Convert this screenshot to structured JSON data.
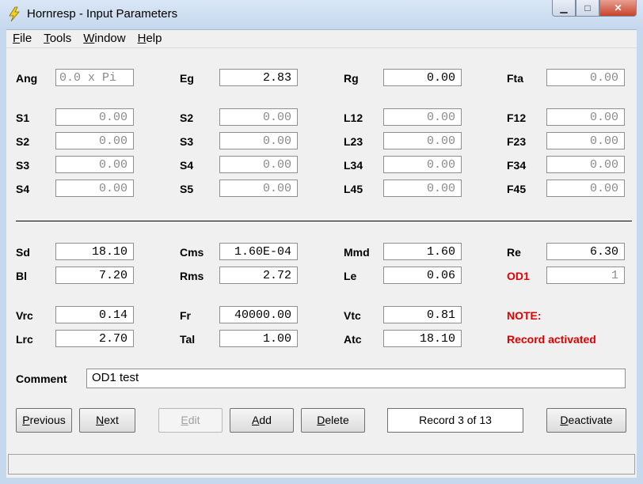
{
  "window": {
    "title": "Hornresp - Input Parameters",
    "minimize": "▁",
    "maximize": "□",
    "close": "✕"
  },
  "menu": [
    {
      "key": "F",
      "rest": "ile"
    },
    {
      "key": "T",
      "rest": "ools"
    },
    {
      "key": "W",
      "rest": "indow"
    },
    {
      "key": "H",
      "rest": "elp"
    }
  ],
  "top": {
    "ang": {
      "label": "Ang",
      "value": "0.0 x Pi"
    },
    "eg": {
      "label": "Eg",
      "value": "2.83"
    },
    "rg": {
      "label": "Rg",
      "value": "0.00"
    },
    "fta": {
      "label": "Fta",
      "value": "0.00"
    }
  },
  "horn": [
    [
      {
        "label": "S1",
        "value": "0.00"
      },
      {
        "label": "S2",
        "value": "0.00"
      },
      {
        "label": "L12",
        "value": "0.00"
      },
      {
        "label": "F12",
        "value": "0.00"
      }
    ],
    [
      {
        "label": "S2",
        "value": "0.00"
      },
      {
        "label": "S3",
        "value": "0.00"
      },
      {
        "label": "L23",
        "value": "0.00"
      },
      {
        "label": "F23",
        "value": "0.00"
      }
    ],
    [
      {
        "label": "S3",
        "value": "0.00"
      },
      {
        "label": "S4",
        "value": "0.00"
      },
      {
        "label": "L34",
        "value": "0.00"
      },
      {
        "label": "F34",
        "value": "0.00"
      }
    ],
    [
      {
        "label": "S4",
        "value": "0.00"
      },
      {
        "label": "S5",
        "value": "0.00"
      },
      {
        "label": "L45",
        "value": "0.00"
      },
      {
        "label": "F45",
        "value": "0.00"
      }
    ]
  ],
  "driver": {
    "sd": {
      "label": "Sd",
      "value": "18.10"
    },
    "cms": {
      "label": "Cms",
      "value": "1.60E-04"
    },
    "mmd": {
      "label": "Mmd",
      "value": "1.60"
    },
    "re": {
      "label": "Re",
      "value": "6.30"
    },
    "bl": {
      "label": "Bl",
      "value": "7.20"
    },
    "rms": {
      "label": "Rms",
      "value": "2.72"
    },
    "le": {
      "label": "Le",
      "value": "0.06"
    },
    "od1": {
      "label": "OD1",
      "value": "1"
    }
  },
  "chamber": {
    "vrc": {
      "label": "Vrc",
      "value": "0.14"
    },
    "fr": {
      "label": "Fr",
      "value": "40000.00"
    },
    "vtc": {
      "label": "Vtc",
      "value": "0.81"
    },
    "lrc": {
      "label": "Lrc",
      "value": "2.70"
    },
    "tal": {
      "label": "Tal",
      "value": "1.00"
    },
    "atc": {
      "label": "Atc",
      "value": "18.10"
    }
  },
  "note": {
    "label": "NOTE:",
    "message": "Record activated"
  },
  "comment": {
    "label": "Comment",
    "value": "OD1 test"
  },
  "buttons": {
    "previous": {
      "key": "P",
      "rest": "revious"
    },
    "next": {
      "key": "N",
      "rest": "ext"
    },
    "edit": {
      "key": "E",
      "rest": "dit"
    },
    "add": {
      "key": "A",
      "rest": "dd"
    },
    "delete": {
      "key": "D",
      "rest": "elete"
    },
    "deactivate": {
      "key": "D",
      "rest": "eactivate"
    }
  },
  "record": "Record 3 of 13",
  "colors": {
    "note_red": "#e00000",
    "title_bar": "#c6d8ee"
  }
}
